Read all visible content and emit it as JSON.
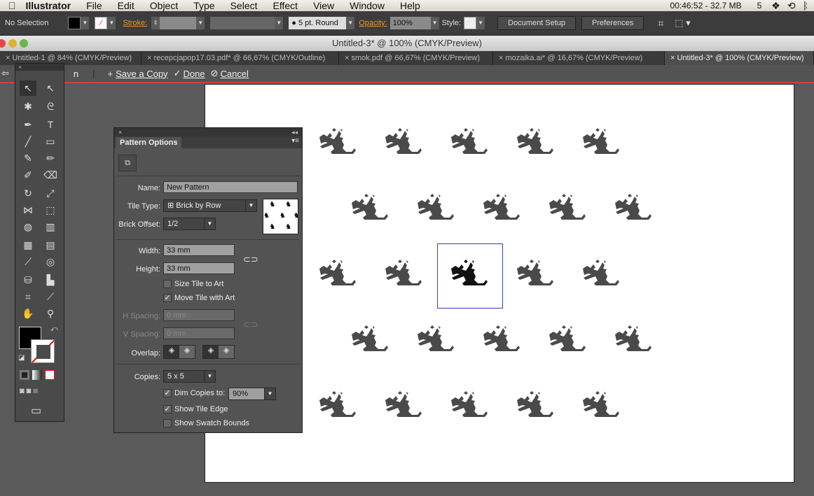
{
  "menubar": {
    "app": "Illustrator",
    "items": [
      "File",
      "Edit",
      "Object",
      "Type",
      "Select",
      "Effect",
      "View",
      "Window",
      "Help"
    ],
    "status": "00:46:52 - 32.7 MB",
    "adobe_count": "5"
  },
  "control": {
    "selection": "No Selection",
    "stroke_label": "Stroke:",
    "brush": "5 pt. Round",
    "opacity_label": "Opacity:",
    "opacity": "100%",
    "style_label": "Style:",
    "document_setup": "Document Setup",
    "preferences": "Preferences"
  },
  "window": {
    "title": "Untitled-3* @ 100% (CMYK/Preview)"
  },
  "tabs": [
    {
      "label": "Untitled-1 @ 84% (CMYK/Preview)"
    },
    {
      "label": "recepcjapop17.03.pdf* @ 66,67% (CMYK/Outline)"
    },
    {
      "label": "smok.pdf @ 66,67% (CMYK/Preview)"
    },
    {
      "label": "mozaika.ai* @ 16,67% (CMYK/Preview)"
    },
    {
      "label": "Untitled-3* @ 100% (CMYK/Preview)",
      "active": true
    }
  ],
  "isolation": {
    "partial": "n",
    "save_copy": "Save a Copy",
    "done": "Done",
    "cancel": "Cancel"
  },
  "panel": {
    "title": "Pattern Options",
    "name_label": "Name:",
    "name": "New Pattern",
    "tile_type_label": "Tile Type:",
    "tile_type": "Brick by Row",
    "brick_offset_label": "Brick Offset:",
    "brick_offset": "1/2",
    "width_label": "Width:",
    "width": "33 mm",
    "height_label": "Height:",
    "height": "33 mm",
    "size_tile": "Size Tile to Art",
    "size_tile_checked": false,
    "move_tile": "Move Tile with Art",
    "move_tile_checked": true,
    "h_spacing_label": "H Spacing:",
    "h_spacing": "0 mm",
    "v_spacing_label": "V Spacing:",
    "v_spacing": "0 mm",
    "overlap_label": "Overlap:",
    "copies_label": "Copies:",
    "copies": "5 x 5",
    "dim_copies": "Dim Copies to:",
    "dim_copies_checked": true,
    "dim_value": "90%",
    "show_tile_edge": "Show Tile Edge",
    "show_tile_edge_checked": true,
    "show_swatch_bounds": "Show Swatch Bounds",
    "show_swatch_bounds_checked": false
  },
  "colors": {
    "accent_orange": "#e29a2d",
    "isolation_border": "#d04040",
    "tile_edge": "#3040c0"
  }
}
